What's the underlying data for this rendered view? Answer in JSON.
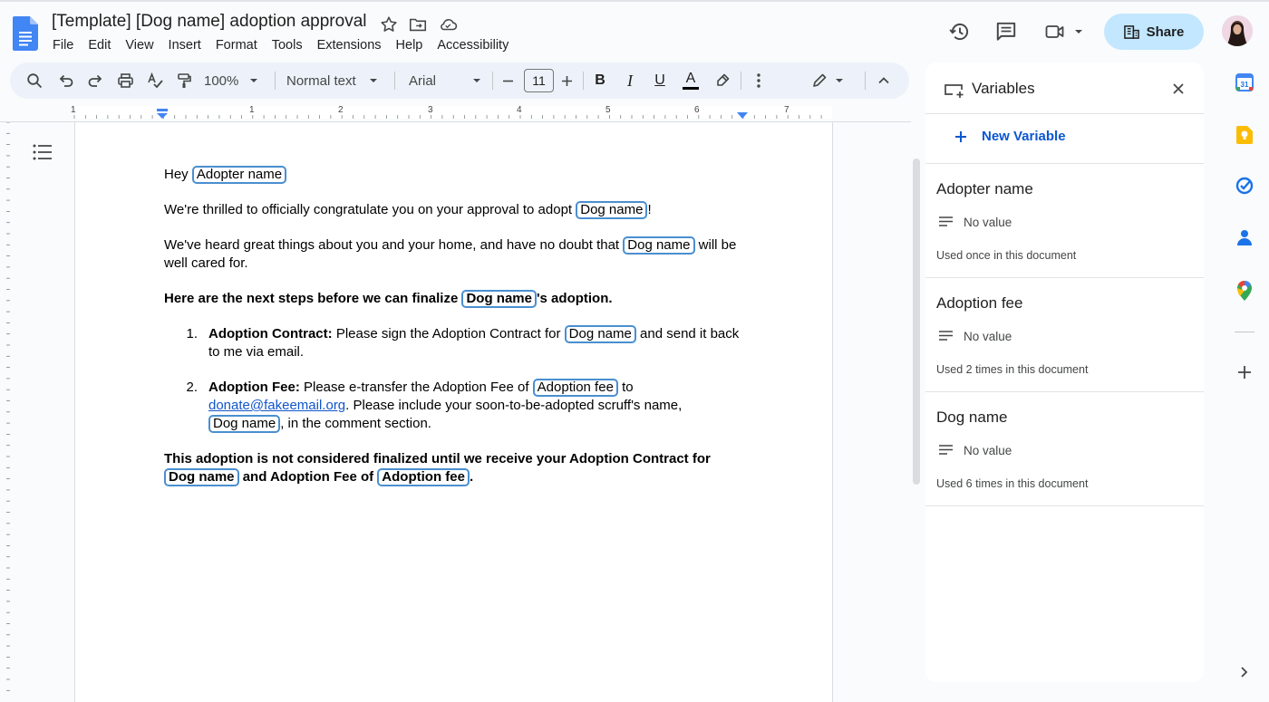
{
  "doc": {
    "title": "[Template] [Dog name] adoption approval",
    "menus": [
      "File",
      "Edit",
      "View",
      "Insert",
      "Format",
      "Tools",
      "Extensions",
      "Help",
      "Accessibility"
    ]
  },
  "header": {
    "share_label": "Share"
  },
  "toolbar": {
    "zoom": "100%",
    "style": "Normal text",
    "font": "Arial",
    "font_size": "11",
    "bold": "B",
    "italic": "I",
    "underline": "U",
    "text_color_glyph": "A"
  },
  "ruler": {
    "marks": [
      "1",
      "1",
      "2",
      "3",
      "4",
      "5",
      "6",
      "7"
    ]
  },
  "content": {
    "greeting": "Hey",
    "p1_before": "We're thrilled to officially congratulate you on your approval to adopt",
    "p1_after": "!",
    "p2_before": "We've heard great things about you and your home, and have no doubt that",
    "p2_after": "will be well cared for.",
    "p3_before": "Here are the next steps before we can finalize",
    "p3_after": "'s adoption.",
    "item1_num": "1.",
    "item1_bold": "Adoption Contract:",
    "item1_before": "Please sign the Adoption Contract for",
    "item1_after": "and send it back to me via email.",
    "item2_num": "2.",
    "item2_bold": "Adoption Fee:",
    "item2_before": "Please e-transfer the Adoption Fee of",
    "item2_to": "to",
    "item2_email": "donate@fakeemail.org",
    "item2_mid": ". Please include your soon-to-be-adopted scruff's name,",
    "item2_after": ", in the comment section.",
    "p4_before": "This adoption is not considered finalized until we receive your Adoption Contract for",
    "p4_mid": "and Adoption Fee of",
    "p4_after": ".",
    "chip_adopter": "Adopter name",
    "chip_dog": "Dog name",
    "chip_fee": "Adoption fee"
  },
  "variables_panel": {
    "title": "Variables",
    "new_label": "New Variable",
    "items": [
      {
        "name": "Adopter name",
        "value": "No value",
        "usage": "Used once in this document"
      },
      {
        "name": "Adoption fee",
        "value": "No value",
        "usage": "Used 2 times in this document"
      },
      {
        "name": "Dog name",
        "value": "No value",
        "usage": "Used 6 times in this document"
      }
    ]
  },
  "colors": {
    "accent": "#1a73e8",
    "share_bg": "#c2e7ff",
    "toolbar_bg": "#edf2fa",
    "chip_border": "#4a8fd0"
  }
}
